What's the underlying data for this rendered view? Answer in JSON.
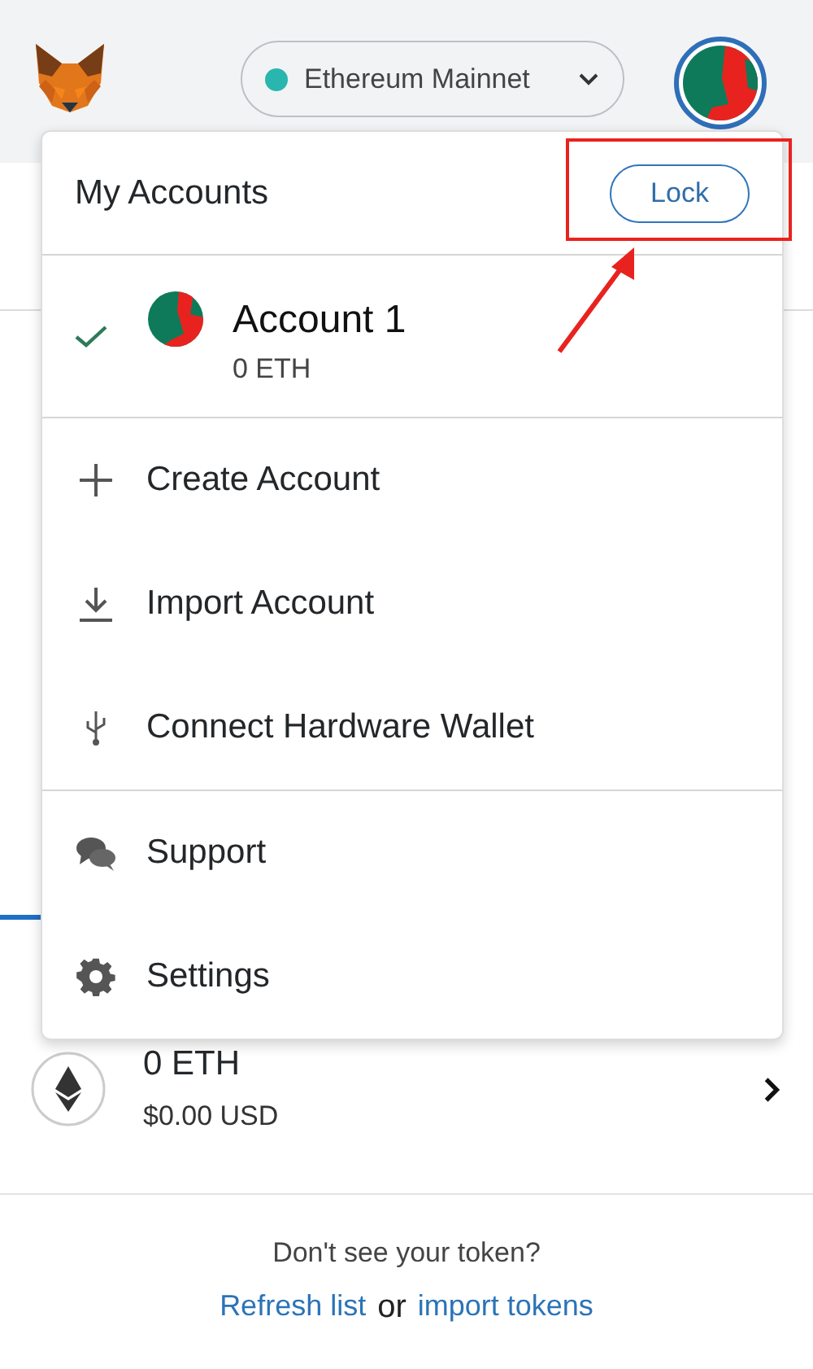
{
  "header": {
    "network": {
      "label": "Ethereum Mainnet",
      "color": "#29b6af"
    }
  },
  "asset": {
    "amount": "0 ETH",
    "fiat": "$0.00 USD"
  },
  "footer": {
    "prompt": "Don't see your token?",
    "refresh_link": "Refresh list",
    "connector": "or",
    "import_link": "import tokens"
  },
  "account_menu": {
    "title": "My Accounts",
    "lock_button": "Lock",
    "accounts": [
      {
        "name": "Account 1",
        "balance": "0 ETH",
        "selected": true
      }
    ],
    "groups": [
      [
        {
          "kind": "create",
          "label": "Create Account"
        },
        {
          "kind": "import",
          "label": "Import Account"
        },
        {
          "kind": "hardware",
          "label": "Connect Hardware Wallet"
        }
      ],
      [
        {
          "kind": "support",
          "label": "Support"
        },
        {
          "kind": "settings",
          "label": "Settings"
        }
      ]
    ]
  }
}
